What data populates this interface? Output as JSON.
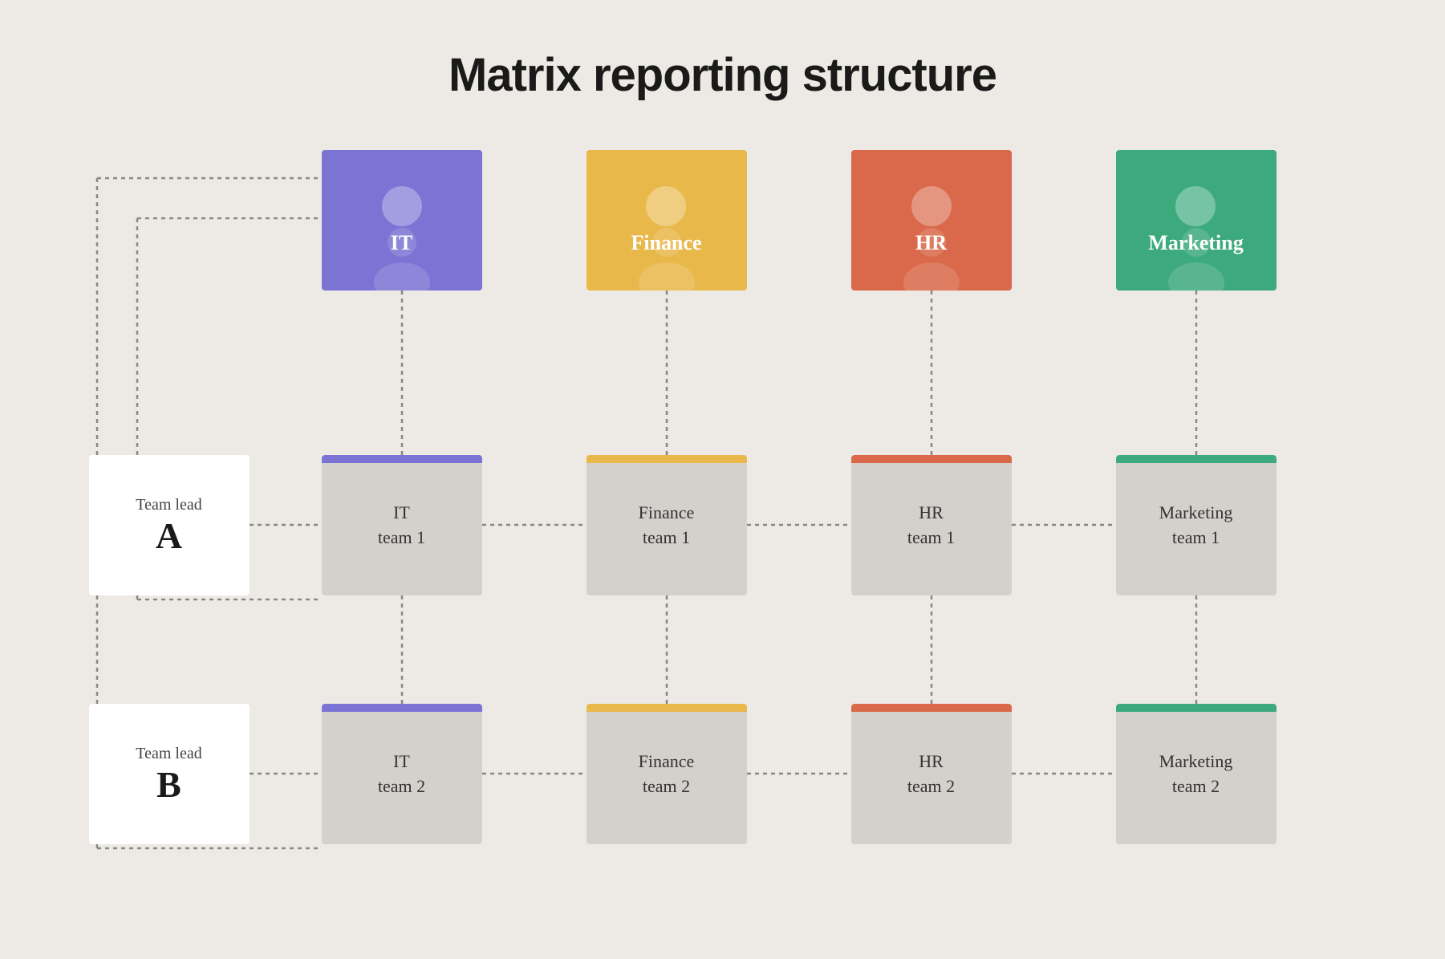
{
  "title": "Matrix reporting structure",
  "departments": [
    {
      "id": "it",
      "label": "IT",
      "color": "#7b74d4",
      "col": 310
    },
    {
      "id": "finance",
      "label": "Finance",
      "color": "#e8b84b",
      "col": 640
    },
    {
      "id": "hr",
      "label": "HR",
      "color": "#d9694a",
      "col": 970
    },
    {
      "id": "marketing",
      "label": "Marketing",
      "color": "#3daa7e",
      "col": 1300
    }
  ],
  "team_leads": [
    {
      "id": "a",
      "title": "Team lead",
      "letter": "A",
      "row": "lead-a"
    },
    {
      "id": "b",
      "title": "Team lead",
      "letter": "B",
      "row": "lead-b"
    }
  ],
  "teams_row1": [
    {
      "id": "it-team-1",
      "line1": "IT",
      "line2": "team 1",
      "bar_class": "bar-it"
    },
    {
      "id": "finance-team-1",
      "line1": "Finance",
      "line2": "team 1",
      "bar_class": "bar-finance"
    },
    {
      "id": "hr-team-1",
      "line1": "HR",
      "line2": "team 1",
      "bar_class": "bar-hr"
    },
    {
      "id": "marketing-team-1",
      "line1": "Marketing",
      "line2": "team 1",
      "bar_class": "bar-marketing"
    }
  ],
  "teams_row2": [
    {
      "id": "it-team-2",
      "line1": "IT",
      "line2": "team 2",
      "bar_class": "bar-it"
    },
    {
      "id": "finance-team-2",
      "line1": "Finance",
      "line2": "team 2",
      "bar_class": "bar-finance"
    },
    {
      "id": "hr-team-2",
      "line1": "HR",
      "line2": "team 2",
      "bar_class": "bar-hr"
    },
    {
      "id": "marketing-team-2",
      "line1": "Marketing",
      "line2": "team 2",
      "bar_class": "bar-marketing"
    }
  ]
}
